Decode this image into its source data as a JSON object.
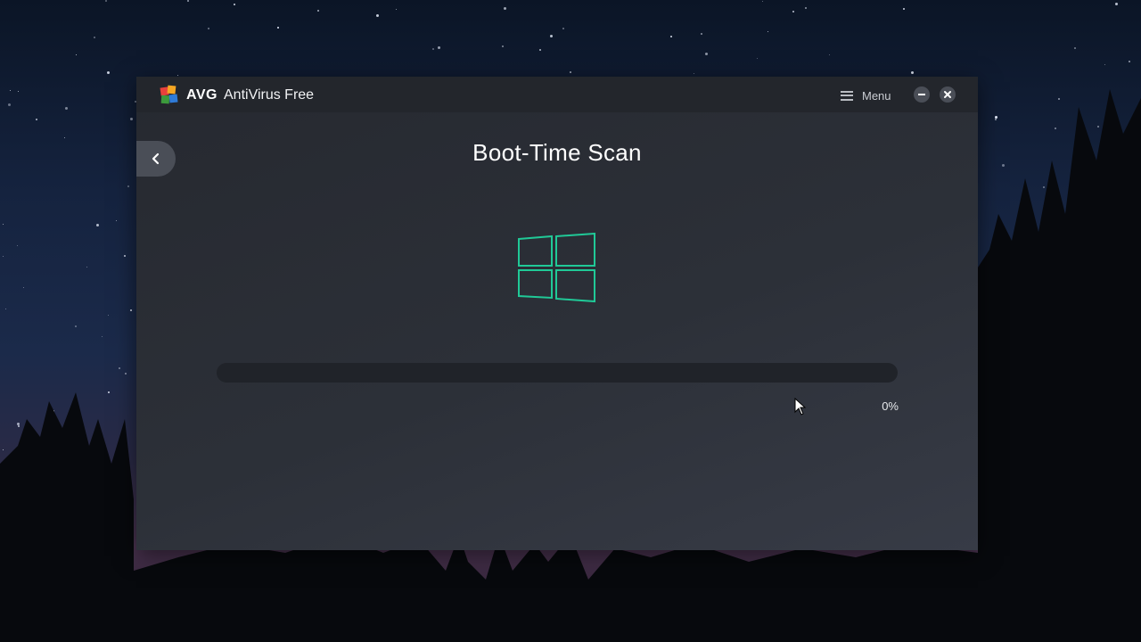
{
  "titlebar": {
    "brand": "AVG",
    "product": "AntiVirus Free",
    "menu_label": "Menu",
    "menu_icon": "hamburger-icon",
    "minimize_icon": "minimize-icon",
    "close_icon": "close-icon"
  },
  "page": {
    "title": "Boot-Time Scan",
    "back_icon": "chevron-left-icon",
    "os_icon": "windows-logo-icon"
  },
  "progress": {
    "value_percent": 0,
    "label": "0%"
  },
  "colors": {
    "accent": "#20c997",
    "window_bg": "#2c3038",
    "titlebar_bg": "#23262c",
    "track_bg": "#202329"
  }
}
